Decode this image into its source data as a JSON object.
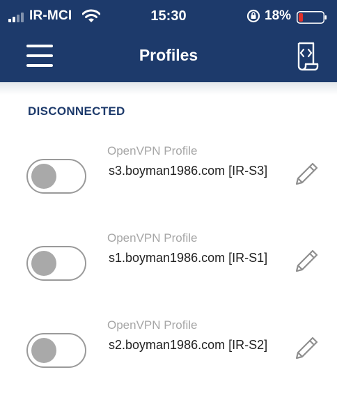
{
  "status_bar": {
    "carrier": "IR-MCI",
    "time": "15:30",
    "battery_percent": "18%",
    "battery_level": 0.18,
    "battery_color": "#e0302a"
  },
  "nav": {
    "title": "Profiles",
    "menu_icon": "hamburger-menu-icon",
    "action_icon": "import-profile-icon"
  },
  "section": {
    "title": "DISCONNECTED"
  },
  "profiles": [
    {
      "type_label": "OpenVPN Profile",
      "name": "s3.boyman1986.com [IR-S3]",
      "enabled": false
    },
    {
      "type_label": "OpenVPN Profile",
      "name": "s1.boyman1986.com [IR-S1]",
      "enabled": false
    },
    {
      "type_label": "OpenVPN Profile",
      "name": "s2.boyman1986.com [IR-S2]",
      "enabled": false
    }
  ],
  "colors": {
    "header": "#1d3a6b",
    "section_title": "#1d3a6b",
    "toggle_off": "#a9a9a9"
  }
}
